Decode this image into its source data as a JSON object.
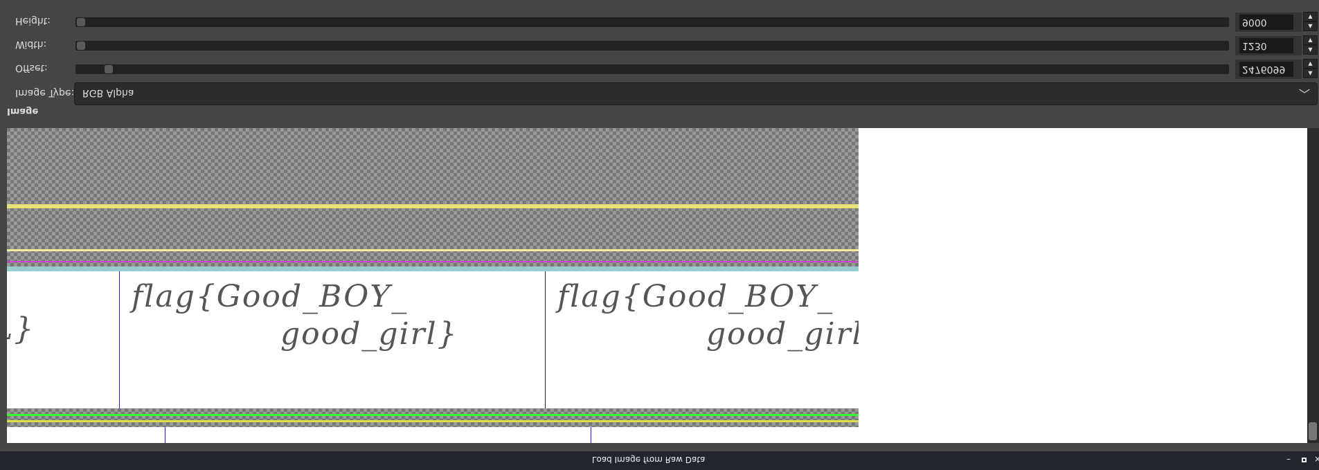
{
  "window": {
    "title": "Load Image from Raw Data"
  },
  "fields": {
    "height": {
      "label": "Height:",
      "value": "9000",
      "slider_fraction": 0.0
    },
    "width": {
      "label": "Width:",
      "value": "1230",
      "slider_fraction": 0.0
    },
    "offset": {
      "label": "Offset:",
      "value": "2476099",
      "slider_fraction": 0.02
    },
    "image_type": {
      "label": "Image Type:",
      "value": "RGB Alpha"
    }
  },
  "preview": {
    "section_label": "Image",
    "content_text": [
      "flag{Good_BOY_",
      "good_girl}"
    ]
  },
  "display": {
    "orientation": "vertically flipped"
  }
}
